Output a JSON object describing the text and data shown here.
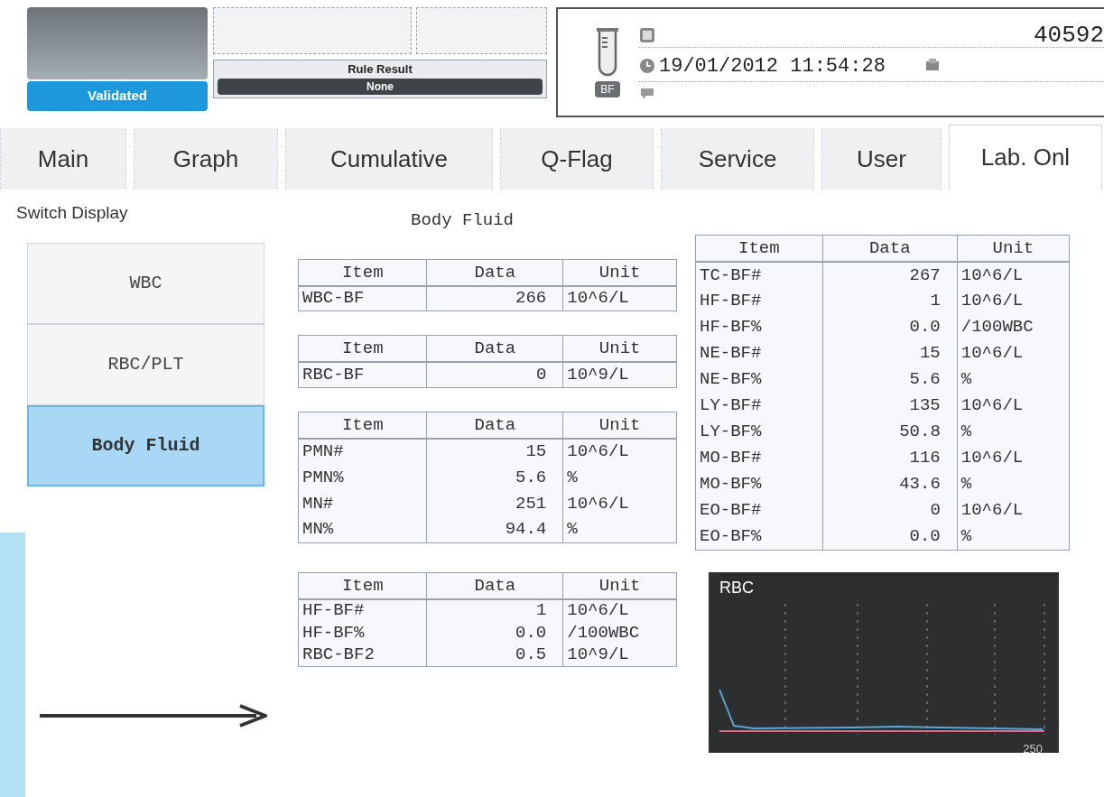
{
  "header": {
    "status": "Validated",
    "rule_result": {
      "label": "Rule Result",
      "value": "None"
    },
    "sample": {
      "tube_label": "BF",
      "datetime": "19/01/2012 11:54:28",
      "sample_no": "40592"
    }
  },
  "tabs": [
    {
      "label": "Main",
      "selected": false
    },
    {
      "label": "Graph",
      "selected": false
    },
    {
      "label": "Cumulative",
      "selected": false
    },
    {
      "label": "Q-Flag",
      "selected": false
    },
    {
      "label": "Service",
      "selected": false
    },
    {
      "label": "User",
      "selected": false
    },
    {
      "label": "Lab. Onl",
      "selected": true
    }
  ],
  "switch_display": {
    "label": "Switch Display",
    "buttons": [
      {
        "label": "WBC",
        "selected": false
      },
      {
        "label": "RBC/PLT",
        "selected": false
      },
      {
        "label": "Body Fluid",
        "selected": true
      }
    ]
  },
  "title": "Body Fluid",
  "tables": [
    {
      "columns": [
        "Item",
        "Data",
        "Unit"
      ],
      "rows": [
        [
          "WBC-BF",
          "266",
          "10^6/L"
        ]
      ]
    },
    {
      "columns": [
        "Item",
        "Data",
        "Unit"
      ],
      "rows": [
        [
          "RBC-BF",
          "0",
          "10^9/L"
        ]
      ]
    },
    {
      "columns": [
        "Item",
        "Data",
        "Unit"
      ],
      "rows": [
        [
          "PMN#",
          "15",
          "10^6/L"
        ],
        [
          "PMN%",
          "5.6",
          "%"
        ],
        [
          "MN#",
          "251",
          "10^6/L"
        ],
        [
          "MN%",
          "94.4",
          "%"
        ]
      ]
    },
    {
      "columns": [
        "Item",
        "Data",
        "Unit"
      ],
      "rows": [
        [
          "HF-BF#",
          "1",
          "10^6/L"
        ],
        [
          "HF-BF%",
          "0.0",
          "/100WBC"
        ],
        [
          "RBC-BF2",
          "0.5",
          "10^9/L"
        ]
      ]
    },
    {
      "columns": [
        "Item",
        "Data",
        "Unit"
      ],
      "rows": [
        [
          "TC-BF#",
          "267",
          "10^6/L"
        ],
        [
          "HF-BF#",
          "1",
          "10^6/L"
        ],
        [
          "HF-BF%",
          "0.0",
          "/100WBC"
        ],
        [
          "NE-BF#",
          "15",
          "10^6/L"
        ],
        [
          "NE-BF%",
          "5.6",
          "%"
        ],
        [
          "LY-BF#",
          "135",
          "10^6/L"
        ],
        [
          "LY-BF%",
          "50.8",
          "%"
        ],
        [
          "MO-BF#",
          "116",
          "10^6/L"
        ],
        [
          "MO-BF%",
          "43.6",
          "%"
        ],
        [
          "EO-BF#",
          "0",
          "10^6/L"
        ],
        [
          "EO-BF%",
          "0.0",
          "%"
        ]
      ]
    }
  ],
  "histogram": {
    "title": "RBC",
    "axis_label": "250"
  }
}
